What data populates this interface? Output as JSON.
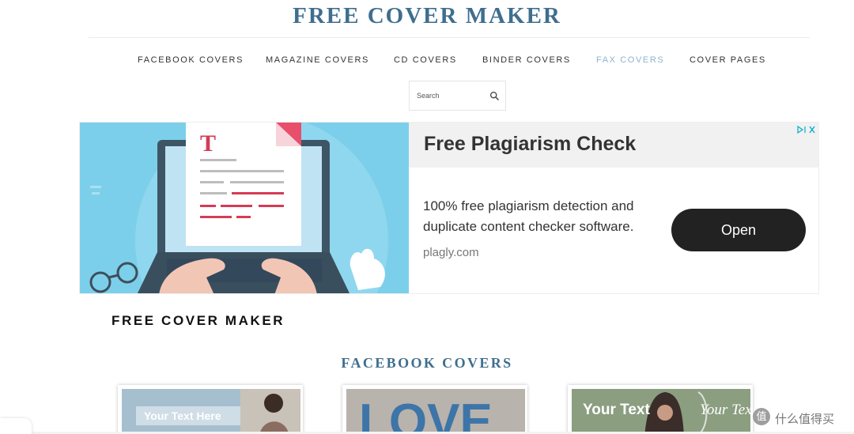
{
  "site": {
    "title": "FREE COVER MAKER"
  },
  "nav": {
    "items": [
      {
        "label": "FACEBOOK COVERS"
      },
      {
        "label": "MAGAZINE COVERS"
      },
      {
        "label": "CD COVERS"
      },
      {
        "label": "BINDER COVERS"
      },
      {
        "label": "FAX COVERS",
        "active": true
      },
      {
        "label": "COVER PAGES"
      }
    ],
    "active_color": "#8db4cc"
  },
  "search": {
    "placeholder": "Search",
    "icon": "search-icon"
  },
  "ad": {
    "headline": "Free Plagiarism Check",
    "description": "100% free plagiarism detection and duplicate content checker software.",
    "domain": "plagly.com",
    "cta": "Open",
    "image_letter": "T",
    "icon": "ad-choices-icon"
  },
  "page": {
    "heading": "FREE COVER MAKER"
  },
  "section": {
    "heading": "FACEBOOK COVERS"
  },
  "thumbnails": [
    {
      "text": "Your Text Here"
    },
    {
      "text": "LOVE"
    },
    {
      "text_left": "Your Text",
      "text_right": "Your Text"
    }
  ],
  "watermark": {
    "logo": "值",
    "text": "什么值得买"
  },
  "colors": {
    "brand": "#3f6e8e",
    "ad_button": "#222222",
    "ad_sky": "#7ccfea"
  }
}
